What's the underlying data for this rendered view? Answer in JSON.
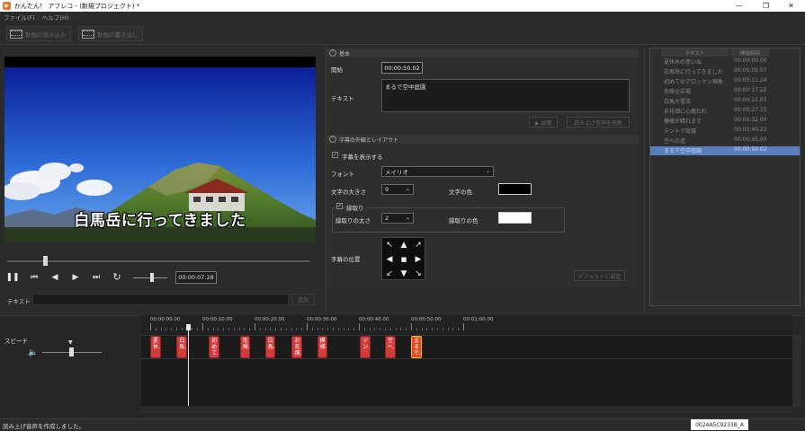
{
  "window": {
    "title": "かんたん！ アフレコ - (新規プロジェクト) *",
    "minimize": "—",
    "maximize": "❐",
    "close": "✕"
  },
  "menu": [
    "ファイル(F)",
    "ヘルプ(H)"
  ],
  "toolbar": {
    "btn1_label": "動画の読み込み",
    "btn2_label": "動画の書き出し"
  },
  "video": {
    "subtitle": "白馬岳に行ってきました",
    "time": "00:00:07.28",
    "seek_fraction": 0.12,
    "volume_fraction": 0.5,
    "text_label": "テキスト",
    "text_button": "追加"
  },
  "basic": {
    "header": "基本",
    "start_label": "開始",
    "start_value": "00:00:50.02",
    "text_label": "テキスト",
    "text_value": "まるで空中庭園",
    "listen_btn": "▶ 試聴",
    "update_btn": "読み上げ音声を更新"
  },
  "appearance": {
    "header": "字幕の外観とレイアウト",
    "show_subtitle": "字幕を表示する",
    "font_label": "フォント",
    "font_value": "メイリオ",
    "size_label": "文字の大きさ",
    "size_value": "9",
    "color_label": "文字の色",
    "text_color": "#000000",
    "outline_label": "縁取り",
    "outline_width_label": "縁取りの太さ",
    "outline_width_value": "2",
    "outline_color_label": "縁取りの色",
    "outline_color": "#ffffff",
    "position_label": "字幕の位置",
    "default_btn": "デフォルトに設定",
    "pad_icons": [
      "arrow-up-left",
      "arrow-up",
      "arrow-up-right",
      "arrow-left",
      "center",
      "arrow-right",
      "arrow-down-left",
      "arrow-down",
      "arrow-down-right"
    ]
  },
  "list": {
    "col_text": "テキスト",
    "col_time": "開始時刻",
    "rows": [
      {
        "text": "夏休みの思い出",
        "time": "00:00:00.00"
      },
      {
        "text": "白馬岳に行ってきました",
        "time": "00:00:05.07"
      },
      {
        "text": "初めてのアロッケン現象",
        "time": "00:00:11.24"
      },
      {
        "text": "危険な岩場",
        "time": "00:00:17.22"
      },
      {
        "text": "白馬大雪渓",
        "time": "00:00:22.03"
      },
      {
        "text": "お花畑に心奪われ",
        "time": "00:00:27.15"
      },
      {
        "text": "模様が晴れます",
        "time": "00:00:32.00"
      },
      {
        "text": "テントで就寝",
        "time": "00:00:40.22"
      },
      {
        "text": "空への道",
        "time": "00:00:45.00"
      },
      {
        "text": "まるで空中庭園",
        "time": "00:00:50.02"
      }
    ],
    "selected_index": 9
  },
  "timeline": {
    "track_label": "スピーチ",
    "ticks": [
      "00:00:00.00",
      "00:00:10.00",
      "00:00:20.00",
      "00:00:30.00",
      "00:00:40.00",
      "00:00:50.00",
      "00:01:00.00"
    ],
    "clips": [
      {
        "label": "夏休...",
        "start": 0.0
      },
      {
        "label": "白馬...",
        "start": 5.07
      },
      {
        "label": "初めて...",
        "start": 11.24
      },
      {
        "label": "危険...",
        "start": 17.22
      },
      {
        "label": "白馬...",
        "start": 22.03
      },
      {
        "label": "お花畑...",
        "start": 27.15
      },
      {
        "label": "模様...",
        "start": 32.0
      },
      {
        "label": "テン...",
        "start": 40.22
      },
      {
        "label": "空へ...",
        "start": 45.0
      },
      {
        "label": "まるで...",
        "start": 50.02
      }
    ],
    "playhead_seconds": 7.28,
    "clip_duration": 2.0
  },
  "status": {
    "message": "読み上げ音声を作成しました。",
    "id": "0024A5C9233B_A"
  },
  "colors": {
    "clip": "#d23b3b",
    "selected_row": "#5a7fbf",
    "selected_clip_border": "#f2c200"
  }
}
